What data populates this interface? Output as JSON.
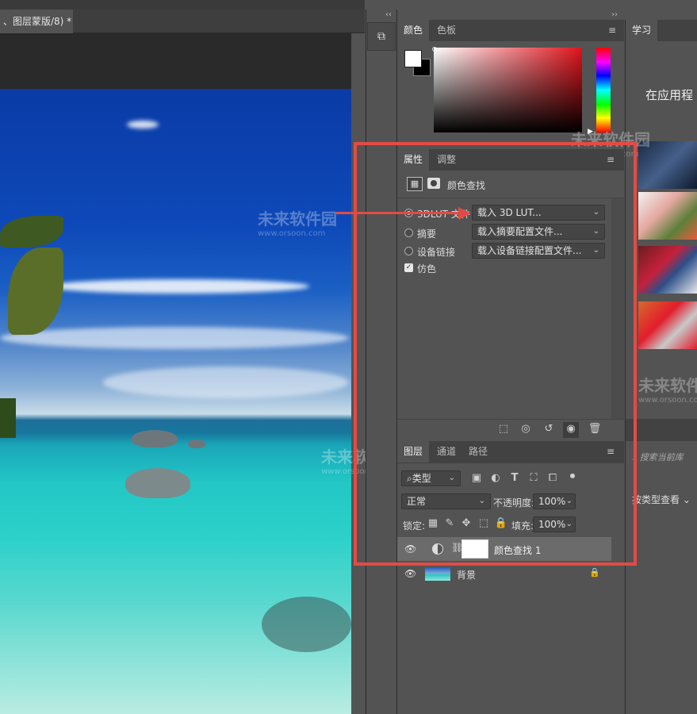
{
  "document": {
    "tab_title": "、图层蒙版/8) *"
  },
  "toolstrip": {
    "collapse_left": "‹‹",
    "collapse_right": "››"
  },
  "color_panel": {
    "tabs": [
      "颜色",
      "色板"
    ],
    "active_tab": 0
  },
  "learn_panel": {
    "tab": "学习",
    "heading": "在应用程"
  },
  "properties": {
    "tabs": [
      "属性",
      "调整"
    ],
    "active_tab": 0,
    "adjustment_name": "颜色查找",
    "rows": [
      {
        "label": "3DLUT 文件",
        "dropdown": "载入 3D LUT...",
        "selected": true
      },
      {
        "label": "摘要",
        "dropdown": "载入摘要配置文件...",
        "selected": false
      },
      {
        "label": "设备链接",
        "dropdown": "载入设备链接配置文件...",
        "selected": false
      }
    ],
    "dither_label": "仿色",
    "dither_checked": true
  },
  "library": {
    "search_placeholder": "搜索当前库",
    "type_view": "按类型查看"
  },
  "layers_panel": {
    "tabs": [
      "图层",
      "通道",
      "路径"
    ],
    "filter_label": "类型",
    "blend_mode": "正常",
    "opacity_label": "不透明度:",
    "opacity_value": "100%",
    "lock_label": "锁定:",
    "fill_label": "填充:",
    "fill_value": "100%",
    "layers": [
      {
        "name": "颜色查找 1",
        "selected": true
      },
      {
        "name": "背景",
        "selected": false
      }
    ]
  },
  "watermark": {
    "brand": "未来软件园",
    "url": "www.orsoon.com"
  },
  "colors": {
    "highlight": "#e24b45",
    "panel_bg": "#535353"
  }
}
